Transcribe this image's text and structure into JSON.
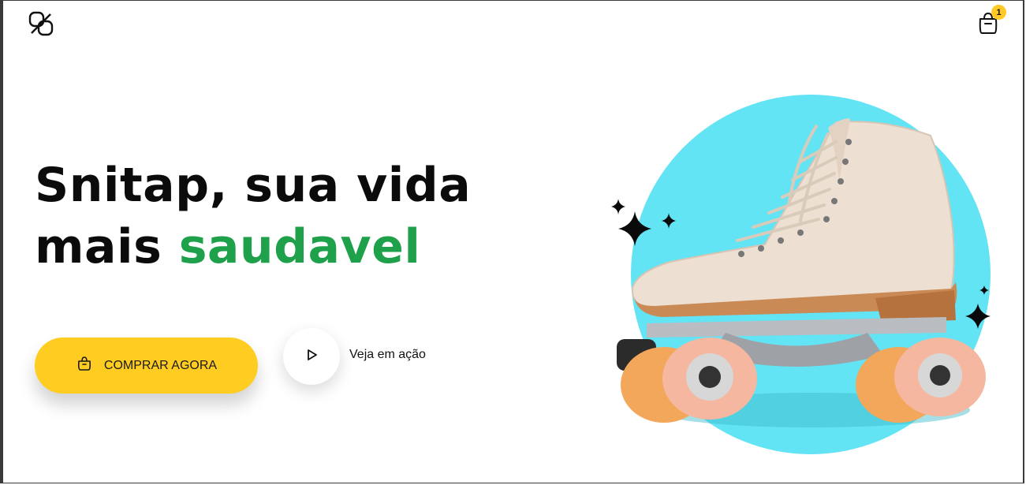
{
  "header": {
    "logo_icon": "snitap-logo-icon",
    "cart_icon": "shopping-bag-icon",
    "cart_count": "1"
  },
  "hero": {
    "headline_part1": "Snitap, sua vida",
    "headline_part2": "mais",
    "headline_accent": "saudavel",
    "buy_button_label": "COMPRAR AGORA",
    "buy_button_icon": "shopping-bag-icon",
    "watch_button_icon": "play-icon",
    "watch_label": "Veja em ação",
    "image_description_icon": "roller-skate-image"
  },
  "colors": {
    "accent_green": "#1fa04a",
    "button_yellow": "#ffcd22",
    "circle_cyan": "#62e4f5",
    "badge_yellow": "#ffc928"
  }
}
